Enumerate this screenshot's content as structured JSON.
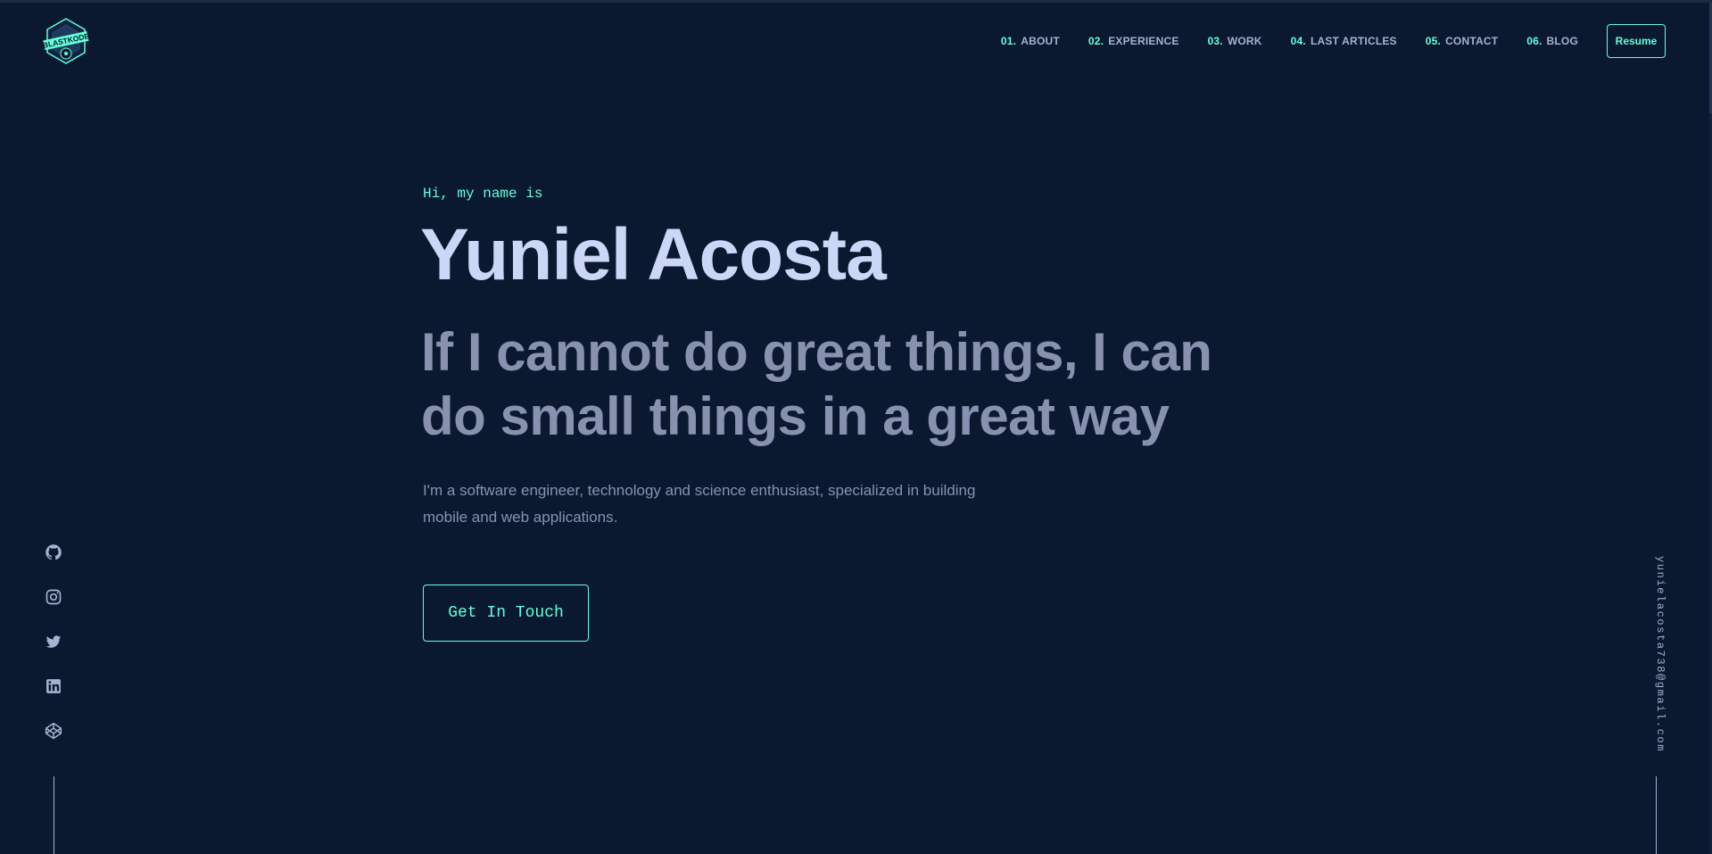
{
  "header": {
    "logo_text": "BLASTKODE",
    "nav": [
      {
        "num": "01.",
        "label": "ABOUT"
      },
      {
        "num": "02.",
        "label": "EXPERIENCE"
      },
      {
        "num": "03.",
        "label": "WORK"
      },
      {
        "num": "04.",
        "label": "LAST ARTICLES"
      },
      {
        "num": "05.",
        "label": "CONTACT"
      },
      {
        "num": "06.",
        "label": "BLOG"
      }
    ],
    "resume_label": "Resume"
  },
  "hero": {
    "greeting": "Hi, my name is",
    "name": "Yuniel Acosta",
    "tagline": "If I cannot do great things, I can do small things in a great way",
    "intro": "I'm a software engineer, technology and science enthusiast, specialized in building mobile and web applications.",
    "cta_label": "Get In Touch"
  },
  "social": {
    "icons": [
      "github-icon",
      "instagram-icon",
      "twitter-icon",
      "linkedin-icon",
      "codepen-icon"
    ]
  },
  "email": "yunielacosta738@gmail.com",
  "colors": {
    "background": "#0a192f",
    "accent": "#64ffda",
    "heading": "#ccd6f6",
    "text": "#8892b0",
    "light_text": "#a8b2d1"
  }
}
